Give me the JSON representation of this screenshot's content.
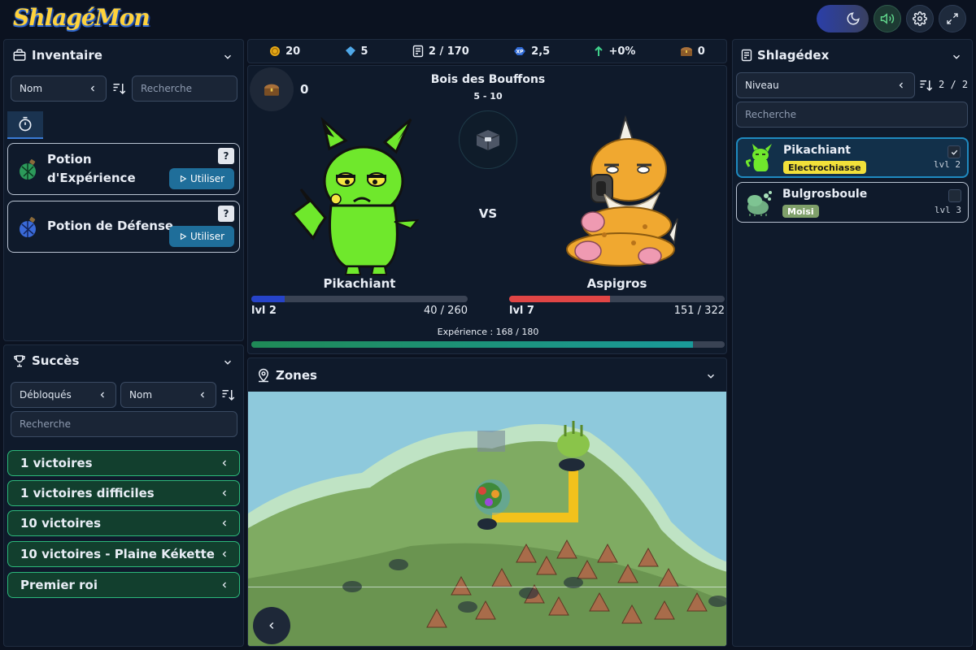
{
  "app": {
    "logo": "ShlagéMon"
  },
  "inventory": {
    "title": "Inventaire",
    "sort_value": "Nom",
    "search_placeholder": "Recherche",
    "items": [
      {
        "name_line1": "Potion",
        "name_line2": "d'Expérience",
        "help": "?",
        "button": "Utiliser"
      },
      {
        "name": "Potion de Défense",
        "help": "?",
        "button": "Utiliser"
      }
    ]
  },
  "achievements": {
    "title": "Succès",
    "filter_value": "Débloqués",
    "sort_value": "Nom",
    "search_placeholder": "Recherche",
    "items": [
      "1 victoires",
      "1 victoires difficiles",
      "10 victoires",
      "10 victoires - Plaine Kékette",
      "Premier roi"
    ]
  },
  "stats": {
    "coins": "20",
    "gems": "5",
    "dex": "2 / 170",
    "xp": "2,5",
    "bonus": "+0%",
    "chests": "0"
  },
  "battle": {
    "zone_name": "Bois des Bouffons",
    "zone_levels": "5 - 10",
    "item_count": "0",
    "vs": "VS",
    "player": {
      "name": "Pikachiant",
      "level": "lvl 2",
      "hp": "40 / 260",
      "hp_ratio": 0.154
    },
    "enemy": {
      "name": "Aspigros",
      "level": "lvl 7",
      "hp": "151 / 322",
      "hp_ratio": 0.469
    },
    "experience": "Expérience : 168 / 180",
    "xp_ratio": 0.933
  },
  "zones": {
    "title": "Zones"
  },
  "shlagedex": {
    "title": "Shlagédex",
    "sort_value": "Niveau",
    "count": "2 / 2",
    "search_placeholder": "Recherche",
    "entries": [
      {
        "name": "Pikachiant",
        "type": "Electrochiasse",
        "level": "lvl 2",
        "checked": true,
        "type_color": "#f2e03a"
      },
      {
        "name": "Bulgrosboule",
        "type": "Moisi",
        "level": "lvl 3",
        "checked": false,
        "type_color": "#7fa06a"
      }
    ]
  },
  "colors": {
    "accent": "#1f6e9a",
    "success": "#2cb87a",
    "hp_player": "#2643c9",
    "hp_enemy": "#e04545"
  }
}
